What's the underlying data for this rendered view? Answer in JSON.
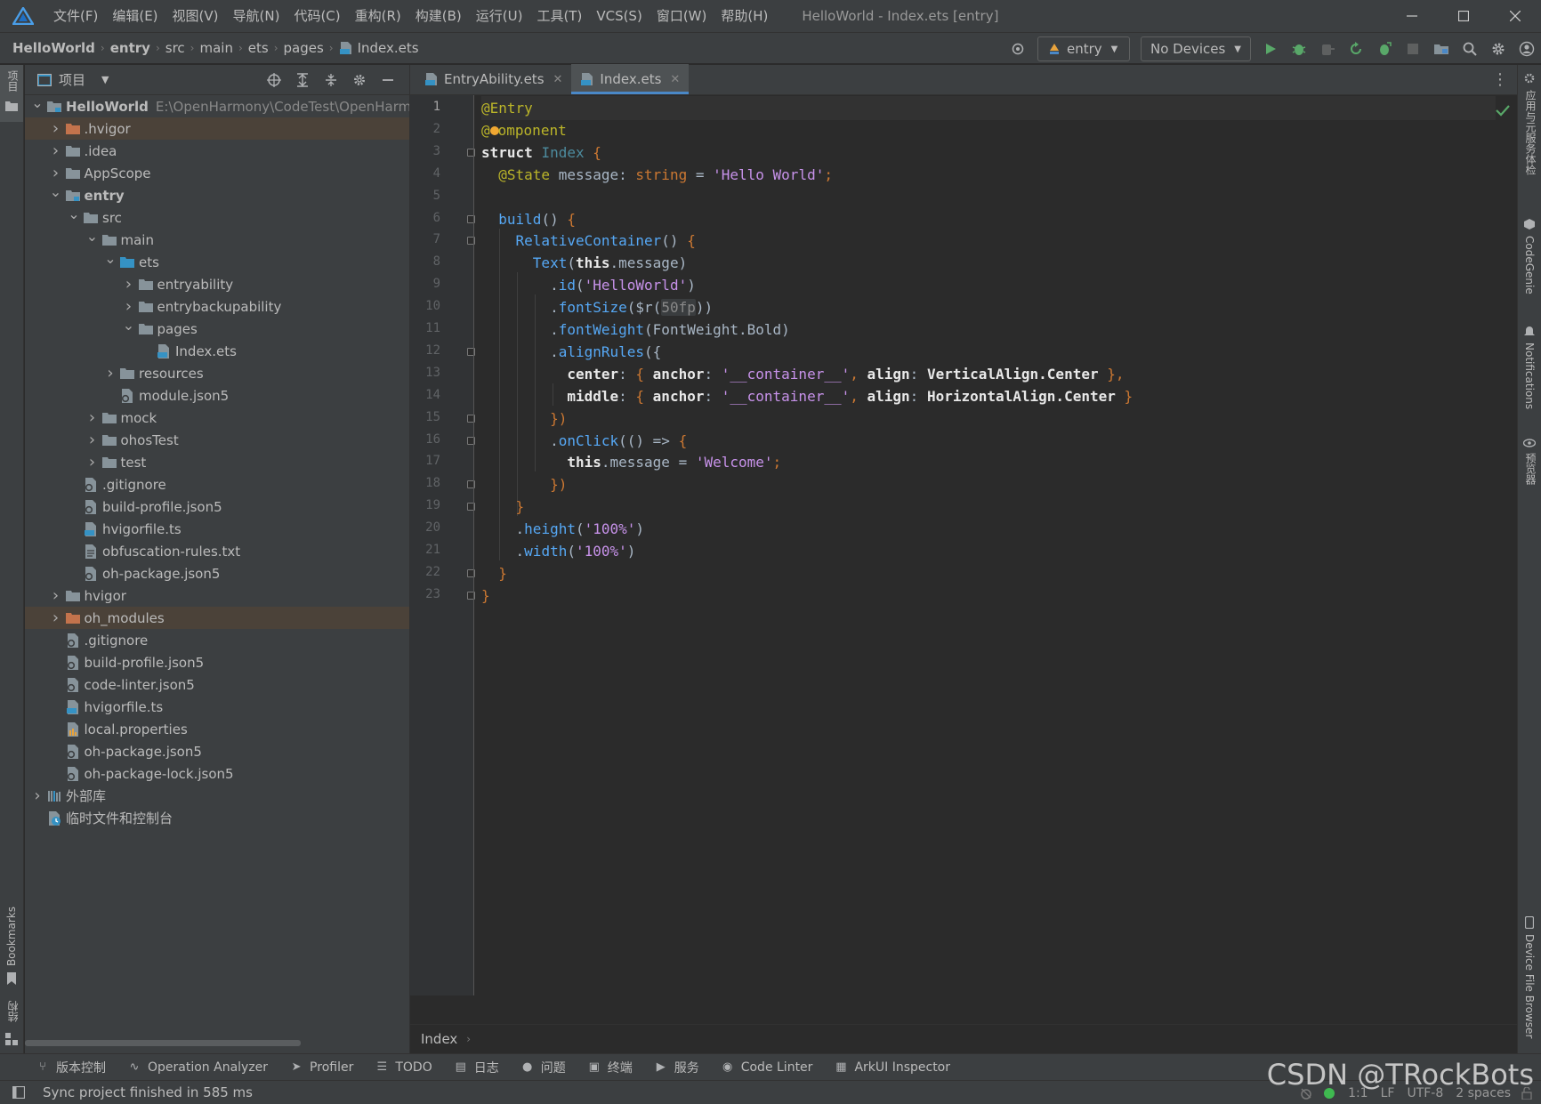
{
  "titlebar": {
    "menus": [
      "文件(F)",
      "编辑(E)",
      "视图(V)",
      "导航(N)",
      "代码(C)",
      "重构(R)",
      "构建(B)",
      "运行(U)",
      "工具(T)",
      "VCS(S)",
      "窗口(W)",
      "帮助(H)"
    ],
    "window_title": "HelloWorld - Index.ets [entry]"
  },
  "breadcrumb": [
    "HelloWorld",
    "entry",
    "src",
    "main",
    "ets",
    "pages",
    "Index.ets"
  ],
  "run_config": {
    "module": "entry",
    "device": "No Devices"
  },
  "left_strip": {
    "project_tab": "项目",
    "bookmarks_tab": "Bookmarks",
    "structure_tab": "结构"
  },
  "right_strip": {
    "tab1": "应用与元服务体检",
    "tab2": "CodeGenie",
    "tab3": "Notifications",
    "tab4": "预览器",
    "tab5": "Device File Browser"
  },
  "project_panel": {
    "title": "项目",
    "tree": [
      {
        "label": "HelloWorld",
        "path": "E:\\OpenHarmony\\CodeTest\\OpenHarm",
        "indent": 0,
        "arrow": "open",
        "icon": "module-folder-icon",
        "bold": true
      },
      {
        "label": ".hvigor",
        "indent": 1,
        "arrow": "closed",
        "icon": "orange-folder-icon",
        "hl": true
      },
      {
        "label": ".idea",
        "indent": 1,
        "arrow": "closed",
        "icon": "folder-icon"
      },
      {
        "label": "AppScope",
        "indent": 1,
        "arrow": "closed",
        "icon": "folder-icon"
      },
      {
        "label": "entry",
        "indent": 1,
        "arrow": "open",
        "icon": "module-folder-icon",
        "bold": true
      },
      {
        "label": "src",
        "indent": 2,
        "arrow": "open",
        "icon": "folder-icon"
      },
      {
        "label": "main",
        "indent": 3,
        "arrow": "open",
        "icon": "folder-icon"
      },
      {
        "label": "ets",
        "indent": 4,
        "arrow": "open",
        "icon": "blue-folder-icon"
      },
      {
        "label": "entryability",
        "indent": 5,
        "arrow": "closed",
        "icon": "folder-icon"
      },
      {
        "label": "entrybackupability",
        "indent": 5,
        "arrow": "closed",
        "icon": "folder-icon"
      },
      {
        "label": "pages",
        "indent": 5,
        "arrow": "open",
        "icon": "folder-icon"
      },
      {
        "label": "Index.ets",
        "indent": 6,
        "arrow": "none",
        "icon": "ets-file-icon"
      },
      {
        "label": "resources",
        "indent": 4,
        "arrow": "closed",
        "icon": "folder-icon"
      },
      {
        "label": "module.json5",
        "indent": 4,
        "arrow": "none",
        "icon": "json-file-icon"
      },
      {
        "label": "mock",
        "indent": 3,
        "arrow": "closed",
        "icon": "folder-icon"
      },
      {
        "label": "ohosTest",
        "indent": 3,
        "arrow": "closed",
        "icon": "folder-icon"
      },
      {
        "label": "test",
        "indent": 3,
        "arrow": "closed",
        "icon": "folder-icon"
      },
      {
        "label": ".gitignore",
        "indent": 2,
        "arrow": "none",
        "icon": "json-file-icon"
      },
      {
        "label": "build-profile.json5",
        "indent": 2,
        "arrow": "none",
        "icon": "json-file-icon"
      },
      {
        "label": "hvigorfile.ts",
        "indent": 2,
        "arrow": "none",
        "icon": "ts-file-icon"
      },
      {
        "label": "obfuscation-rules.txt",
        "indent": 2,
        "arrow": "none",
        "icon": "text-file-icon"
      },
      {
        "label": "oh-package.json5",
        "indent": 2,
        "arrow": "none",
        "icon": "json-file-icon"
      },
      {
        "label": "hvigor",
        "indent": 1,
        "arrow": "closed",
        "icon": "folder-icon"
      },
      {
        "label": "oh_modules",
        "indent": 1,
        "arrow": "closed",
        "icon": "orange-folder-icon",
        "hl": true
      },
      {
        "label": ".gitignore",
        "indent": 1,
        "arrow": "none",
        "icon": "json-file-icon"
      },
      {
        "label": "build-profile.json5",
        "indent": 1,
        "arrow": "none",
        "icon": "json-file-icon"
      },
      {
        "label": "code-linter.json5",
        "indent": 1,
        "arrow": "none",
        "icon": "json-file-icon"
      },
      {
        "label": "hvigorfile.ts",
        "indent": 1,
        "arrow": "none",
        "icon": "ts-file-icon"
      },
      {
        "label": "local.properties",
        "indent": 1,
        "arrow": "none",
        "icon": "properties-file-icon"
      },
      {
        "label": "oh-package.json5",
        "indent": 1,
        "arrow": "none",
        "icon": "json-file-icon"
      },
      {
        "label": "oh-package-lock.json5",
        "indent": 1,
        "arrow": "none",
        "icon": "json-file-icon"
      },
      {
        "label": "外部库",
        "indent": 0,
        "arrow": "closed",
        "icon": "library-icon"
      },
      {
        "label": "临时文件和控制台",
        "indent": 0,
        "arrow": "none",
        "icon": "scratch-icon"
      }
    ]
  },
  "editor": {
    "tabs": [
      {
        "label": "EntryAbility.ets",
        "active": false
      },
      {
        "label": "Index.ets",
        "active": true
      }
    ],
    "line_numbers": [
      "1",
      "2",
      "3",
      "4",
      "5",
      "6",
      "7",
      "8",
      "9",
      "10",
      "11",
      "12",
      "13",
      "14",
      "15",
      "16",
      "17",
      "18",
      "19",
      "20",
      "21",
      "22",
      "23"
    ],
    "code": {
      "l1": "@Entry",
      "l2a": "@",
      "l2b": "mponent",
      "l3_kw": "struct",
      "l3_name": "Index",
      "l4_dec": "@State",
      "l4_var": "message",
      "l4_type": "string",
      "l4_str": "'Hello World'",
      "l6_fn": "build",
      "l7_fn": "RelativeContainer",
      "l8_fn": "Text",
      "l8_this": "this",
      "l8_prop": "message",
      "l9_fn": "id",
      "l9_str": "'HelloWorld'",
      "l10_fn": "fontSize",
      "l10_res": "$r",
      "l10_arg": "50fp",
      "l11_fn": "fontWeight",
      "l11_arg": "FontWeight.Bold",
      "l12_fn": "alignRules",
      "l13_key": "center",
      "l13_anchor": "anchor",
      "l13_str": "'__container__'",
      "l13_align": "align",
      "l13_val": "VerticalAlign.Center",
      "l14_key": "middle",
      "l14_anchor": "anchor",
      "l14_str": "'__container__'",
      "l14_align": "align",
      "l14_val": "HorizontalAlign.Center",
      "l16_fn": "onClick",
      "l17_this": "this",
      "l17_prop": "message",
      "l17_str": "'Welcome'",
      "l20_fn": "height",
      "l20_str": "'100%'",
      "l21_fn": "width",
      "l21_str": "'100%'"
    },
    "footer_breadcrumb": "Index"
  },
  "bottom_tools": [
    {
      "label": "版本控制",
      "icon": "git-branch-icon"
    },
    {
      "label": "Operation Analyzer",
      "icon": "analyzer-icon"
    },
    {
      "label": "Profiler",
      "icon": "profiler-icon"
    },
    {
      "label": "TODO",
      "icon": "todo-list-icon"
    },
    {
      "label": "日志",
      "icon": "log-icon"
    },
    {
      "label": "问题",
      "icon": "problems-icon"
    },
    {
      "label": "终端",
      "icon": "terminal-icon"
    },
    {
      "label": "服务",
      "icon": "services-icon"
    },
    {
      "label": "Code Linter",
      "icon": "code-linter-icon"
    },
    {
      "label": "ArkUI Inspector",
      "icon": "arkui-inspector-icon"
    }
  ],
  "statusbar": {
    "message": "Sync project finished in 585 ms",
    "position": "1:1",
    "line_sep": "LF",
    "encoding": "UTF-8",
    "indent": "2 spaces"
  },
  "watermark": "CSDN @TRockBots",
  "colors": {
    "accent": "#4a88c7",
    "run_green": "#59a869",
    "folder": "#87939a",
    "orange_folder": "#c3734c",
    "blue_folder": "#3592c4"
  }
}
